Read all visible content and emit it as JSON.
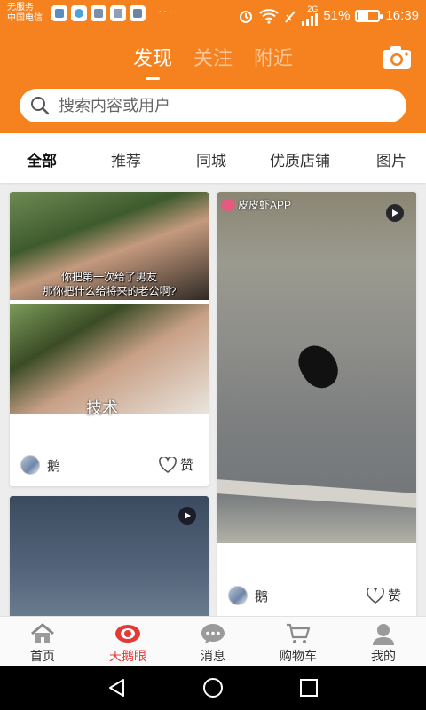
{
  "status_bar": {
    "carrier_line1": "无服务",
    "carrier_line2": "中国电信",
    "more_notifications": "···",
    "network_type": "2G",
    "battery_level": 51,
    "battery_text": "51%",
    "time": "16:39"
  },
  "header": {
    "tabs": [
      {
        "label": "发现",
        "active": true
      },
      {
        "label": "关注",
        "active": false
      },
      {
        "label": "附近",
        "active": false
      }
    ],
    "search_placeholder": "搜索内容或用户",
    "camera_icon": "camera-icon",
    "accent_color": "#f5821f"
  },
  "categories": [
    {
      "label": "全部",
      "active": true
    },
    {
      "label": "推荐",
      "active": false
    },
    {
      "label": "同城",
      "active": false
    },
    {
      "label": "优质店铺",
      "active": false
    },
    {
      "label": "图片",
      "active": false
    }
  ],
  "feed": {
    "cards": [
      {
        "subtitle_line1": "你把第一次给了男友",
        "subtitle_line2": "那你把什么给将来的老公啊?",
        "overlay_text": "技术",
        "author": "鹅",
        "like_label": "赞"
      },
      {
        "watermark": "皮皮虾APP",
        "has_video": true,
        "author": "鹅",
        "like_label": "赞"
      },
      {
        "has_video": true
      }
    ]
  },
  "bottom_nav": [
    {
      "label": "首页",
      "icon": "home-icon",
      "active": false
    },
    {
      "label": "天鹅眼",
      "icon": "eye-icon",
      "active": true
    },
    {
      "label": "消息",
      "icon": "message-icon",
      "active": false
    },
    {
      "label": "购物车",
      "icon": "cart-icon",
      "active": false
    },
    {
      "label": "我的",
      "icon": "profile-icon",
      "active": false
    }
  ],
  "system_nav": [
    "back-icon",
    "home-circle-icon",
    "recents-icon"
  ]
}
